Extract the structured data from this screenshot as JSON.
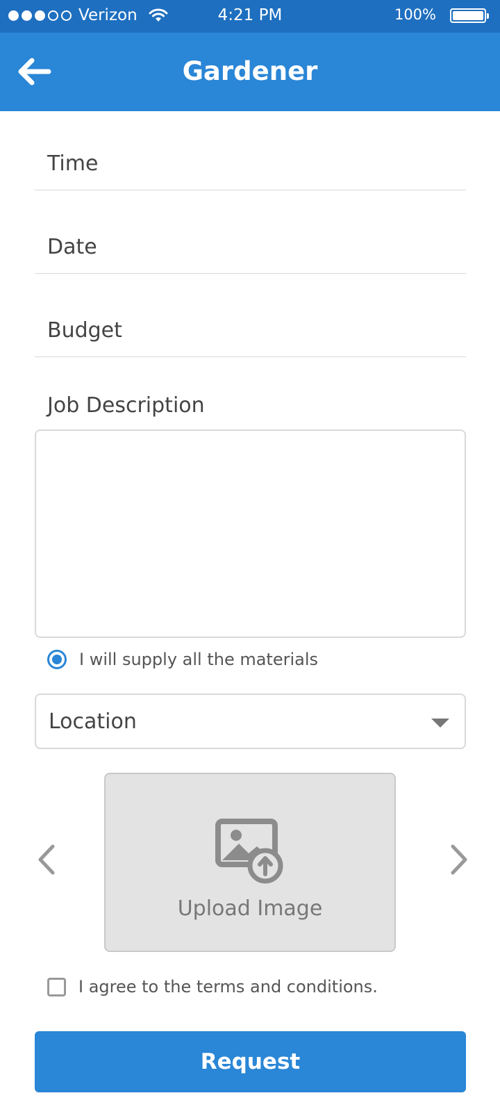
{
  "status_bar": {
    "carrier": "Verizon",
    "time": "4:21 PM",
    "battery": "100%"
  },
  "header": {
    "title": "Gardener"
  },
  "form": {
    "time_placeholder": "Time",
    "date_placeholder": "Date",
    "budget_placeholder": "Budget",
    "job_description_label": "Job Description",
    "supply_materials_label": "I will supply all the materials",
    "location_placeholder": "Location",
    "upload_label": "Upload Image",
    "terms_label": "I agree to the terms and conditions.",
    "submit_label": "Request"
  },
  "colors": {
    "status_bar": "#1e6fc0",
    "app_bar": "#2a86d6",
    "accent": "#2a86d6",
    "upload_bg": "#e3e3e3"
  },
  "icons": [
    "back-arrow-icon",
    "wifi-icon",
    "battery-icon",
    "image-upload-icon",
    "chevron-left-icon",
    "chevron-right-icon",
    "caret-down-icon"
  ]
}
